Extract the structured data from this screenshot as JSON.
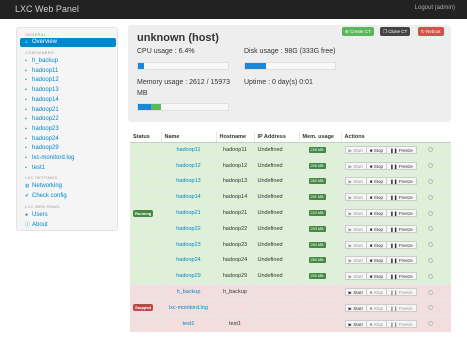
{
  "navbar": {
    "brand": "LXC Web Panel",
    "logout": "Logout (admin)"
  },
  "sidebar": {
    "header_general": "GENERAL",
    "overview": {
      "label": "Overview",
      "icon": "home-icon"
    },
    "header_containers": "CONTAINERS",
    "containers": [
      "h_backup",
      "hadoop11",
      "hadoop12",
      "hadoop13",
      "hadoop14",
      "hadoop21",
      "hadoop22",
      "hadoop23",
      "hadoop24",
      "hadoop29",
      "lxc-monitord.log",
      "test1"
    ],
    "header_settings": "LXC SETTINGS",
    "settings": [
      {
        "label": "Networking",
        "icon": "globe-icon"
      },
      {
        "label": "Check config",
        "icon": "check-icon"
      }
    ],
    "header_panel": "LXC WEB PANEL",
    "panel": [
      {
        "label": "Users",
        "icon": "user-icon"
      },
      {
        "label": "About",
        "icon": "info-icon"
      }
    ]
  },
  "hero": {
    "title": "unknown (host)",
    "buttons": {
      "create": "Create CT",
      "clone": "Clone CT",
      "reboot": "Reboot"
    },
    "cpu": {
      "label": "CPU usage : 6.4%",
      "percent": 6.4
    },
    "disk": {
      "label": "Disk usage : 98G (333G free)",
      "percent": 23
    },
    "memory": {
      "label_line1": "Memory usage : 2612 / 15973",
      "label_line2": "MB",
      "percent_blue": 14,
      "percent_green": 12
    },
    "uptime": "Uptime : 0 day(s) 0:01"
  },
  "table": {
    "headers": {
      "status": "Status",
      "name": "Name",
      "hostname": "Hostname",
      "ip": "IP Address",
      "mem": "Mem. usage",
      "actions": "Actions"
    },
    "status_running": "Running",
    "status_stopped": "Stopped",
    "actions": {
      "start": "Start",
      "stop": "Stop",
      "freeze": "Freeze"
    },
    "running_rows": [
      {
        "name": "hadoop11",
        "hostname": "hadoop11",
        "ip": "Undefined",
        "mem": "235 MB"
      },
      {
        "name": "hadoop12",
        "hostname": "hadoop12",
        "ip": "Undefined",
        "mem": "206 MB"
      },
      {
        "name": "hadoop13",
        "hostname": "hadoop13",
        "ip": "Undefined",
        "mem": "282 MB"
      },
      {
        "name": "hadoop14",
        "hostname": "hadoop14",
        "ip": "Undefined",
        "mem": "291 MB"
      },
      {
        "name": "hadoop21",
        "hostname": "hadoop21",
        "ip": "Undefined",
        "mem": "223 MB"
      },
      {
        "name": "hadoop22",
        "hostname": "hadoop22",
        "ip": "Undefined",
        "mem": "203 MB"
      },
      {
        "name": "hadoop23",
        "hostname": "hadoop23",
        "ip": "Undefined",
        "mem": "284 MB"
      },
      {
        "name": "hadoop24",
        "hostname": "hadoop24",
        "ip": "Undefined",
        "mem": "280 MB"
      },
      {
        "name": "hadoop29",
        "hostname": "hadoop29",
        "ip": "Undefined",
        "mem": "200 MB"
      }
    ],
    "stopped_rows": [
      {
        "name": "h_backup",
        "hostname": "h_backup",
        "ip": "",
        "mem": ""
      },
      {
        "name": "lxc-monitord.log",
        "hostname": "",
        "ip": "",
        "mem": ""
      },
      {
        "name": "test1",
        "hostname": "test1",
        "ip": "",
        "mem": ""
      }
    ]
  }
}
